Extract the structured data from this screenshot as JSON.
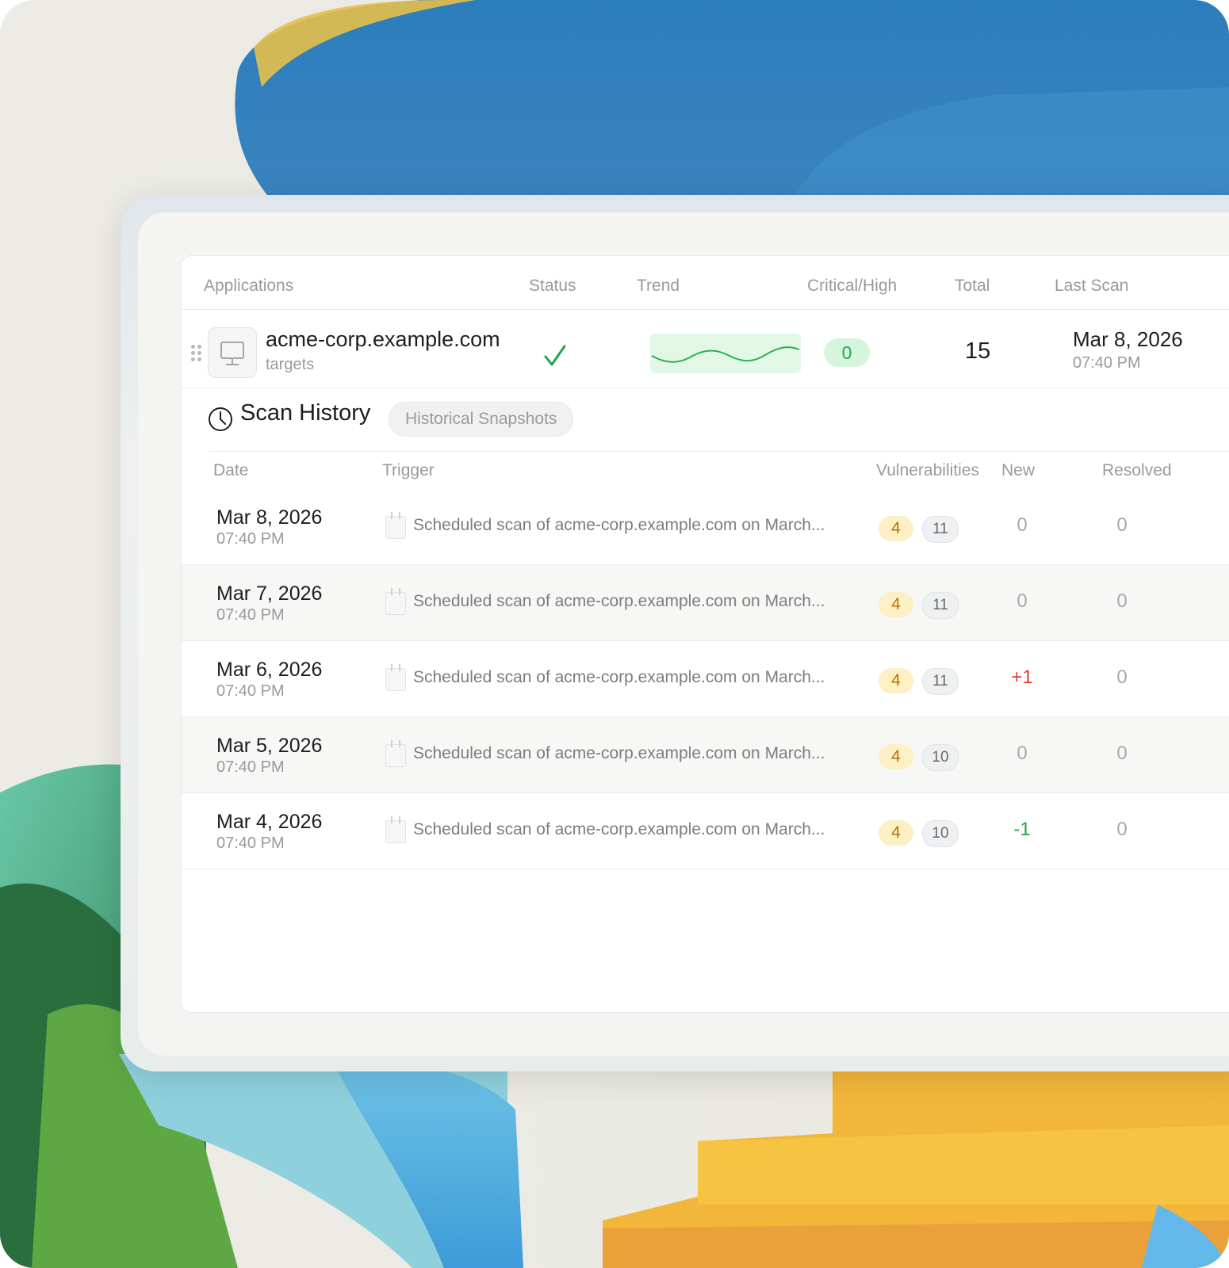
{
  "applications_table": {
    "headers": {
      "applications": "Applications",
      "status": "Status",
      "trend": "Trend",
      "critical_high": "Critical/High",
      "total": "Total",
      "last_scan": "Last Scan"
    },
    "row": {
      "name": "acme-corp.example.com",
      "subtitle": "targets",
      "status_icon": "check-icon",
      "critical_high": "0",
      "total": "15",
      "last_scan_date": "Mar 8, 2026",
      "last_scan_time": "07:40 PM"
    }
  },
  "scan_history": {
    "title": "Scan History",
    "badge": "Historical Snapshots",
    "headers": {
      "date": "Date",
      "trigger": "Trigger",
      "vulnerabilities": "Vulnerabilities",
      "new": "New",
      "resolved": "Resolved"
    },
    "rows": [
      {
        "date": "Mar 8, 2026",
        "time": "07:40 PM",
        "trigger": "Scheduled scan of acme-corp.example.com on March...",
        "critical": "4",
        "total": "11",
        "new": "0",
        "resolved": "0"
      },
      {
        "date": "Mar 7, 2026",
        "time": "07:40 PM",
        "trigger": "Scheduled scan of acme-corp.example.com on March...",
        "critical": "4",
        "total": "11",
        "new": "0",
        "resolved": "0"
      },
      {
        "date": "Mar 6, 2026",
        "time": "07:40 PM",
        "trigger": "Scheduled scan of acme-corp.example.com on March...",
        "critical": "4",
        "total": "11",
        "new": "+1",
        "resolved": "0"
      },
      {
        "date": "Mar 5, 2026",
        "time": "07:40 PM",
        "trigger": "Scheduled scan of acme-corp.example.com on March...",
        "critical": "4",
        "total": "10",
        "new": "0",
        "resolved": "0"
      },
      {
        "date": "Mar 4, 2026",
        "time": "07:40 PM",
        "trigger": "Scheduled scan of acme-corp.example.com on March...",
        "critical": "4",
        "total": "10",
        "new": "-1",
        "resolved": "0"
      }
    ]
  },
  "colors": {
    "accent_green": "#22a447",
    "new_up": "#e53935",
    "new_down": "#2e9e4c",
    "critical_badge": "#fdf0c4"
  }
}
